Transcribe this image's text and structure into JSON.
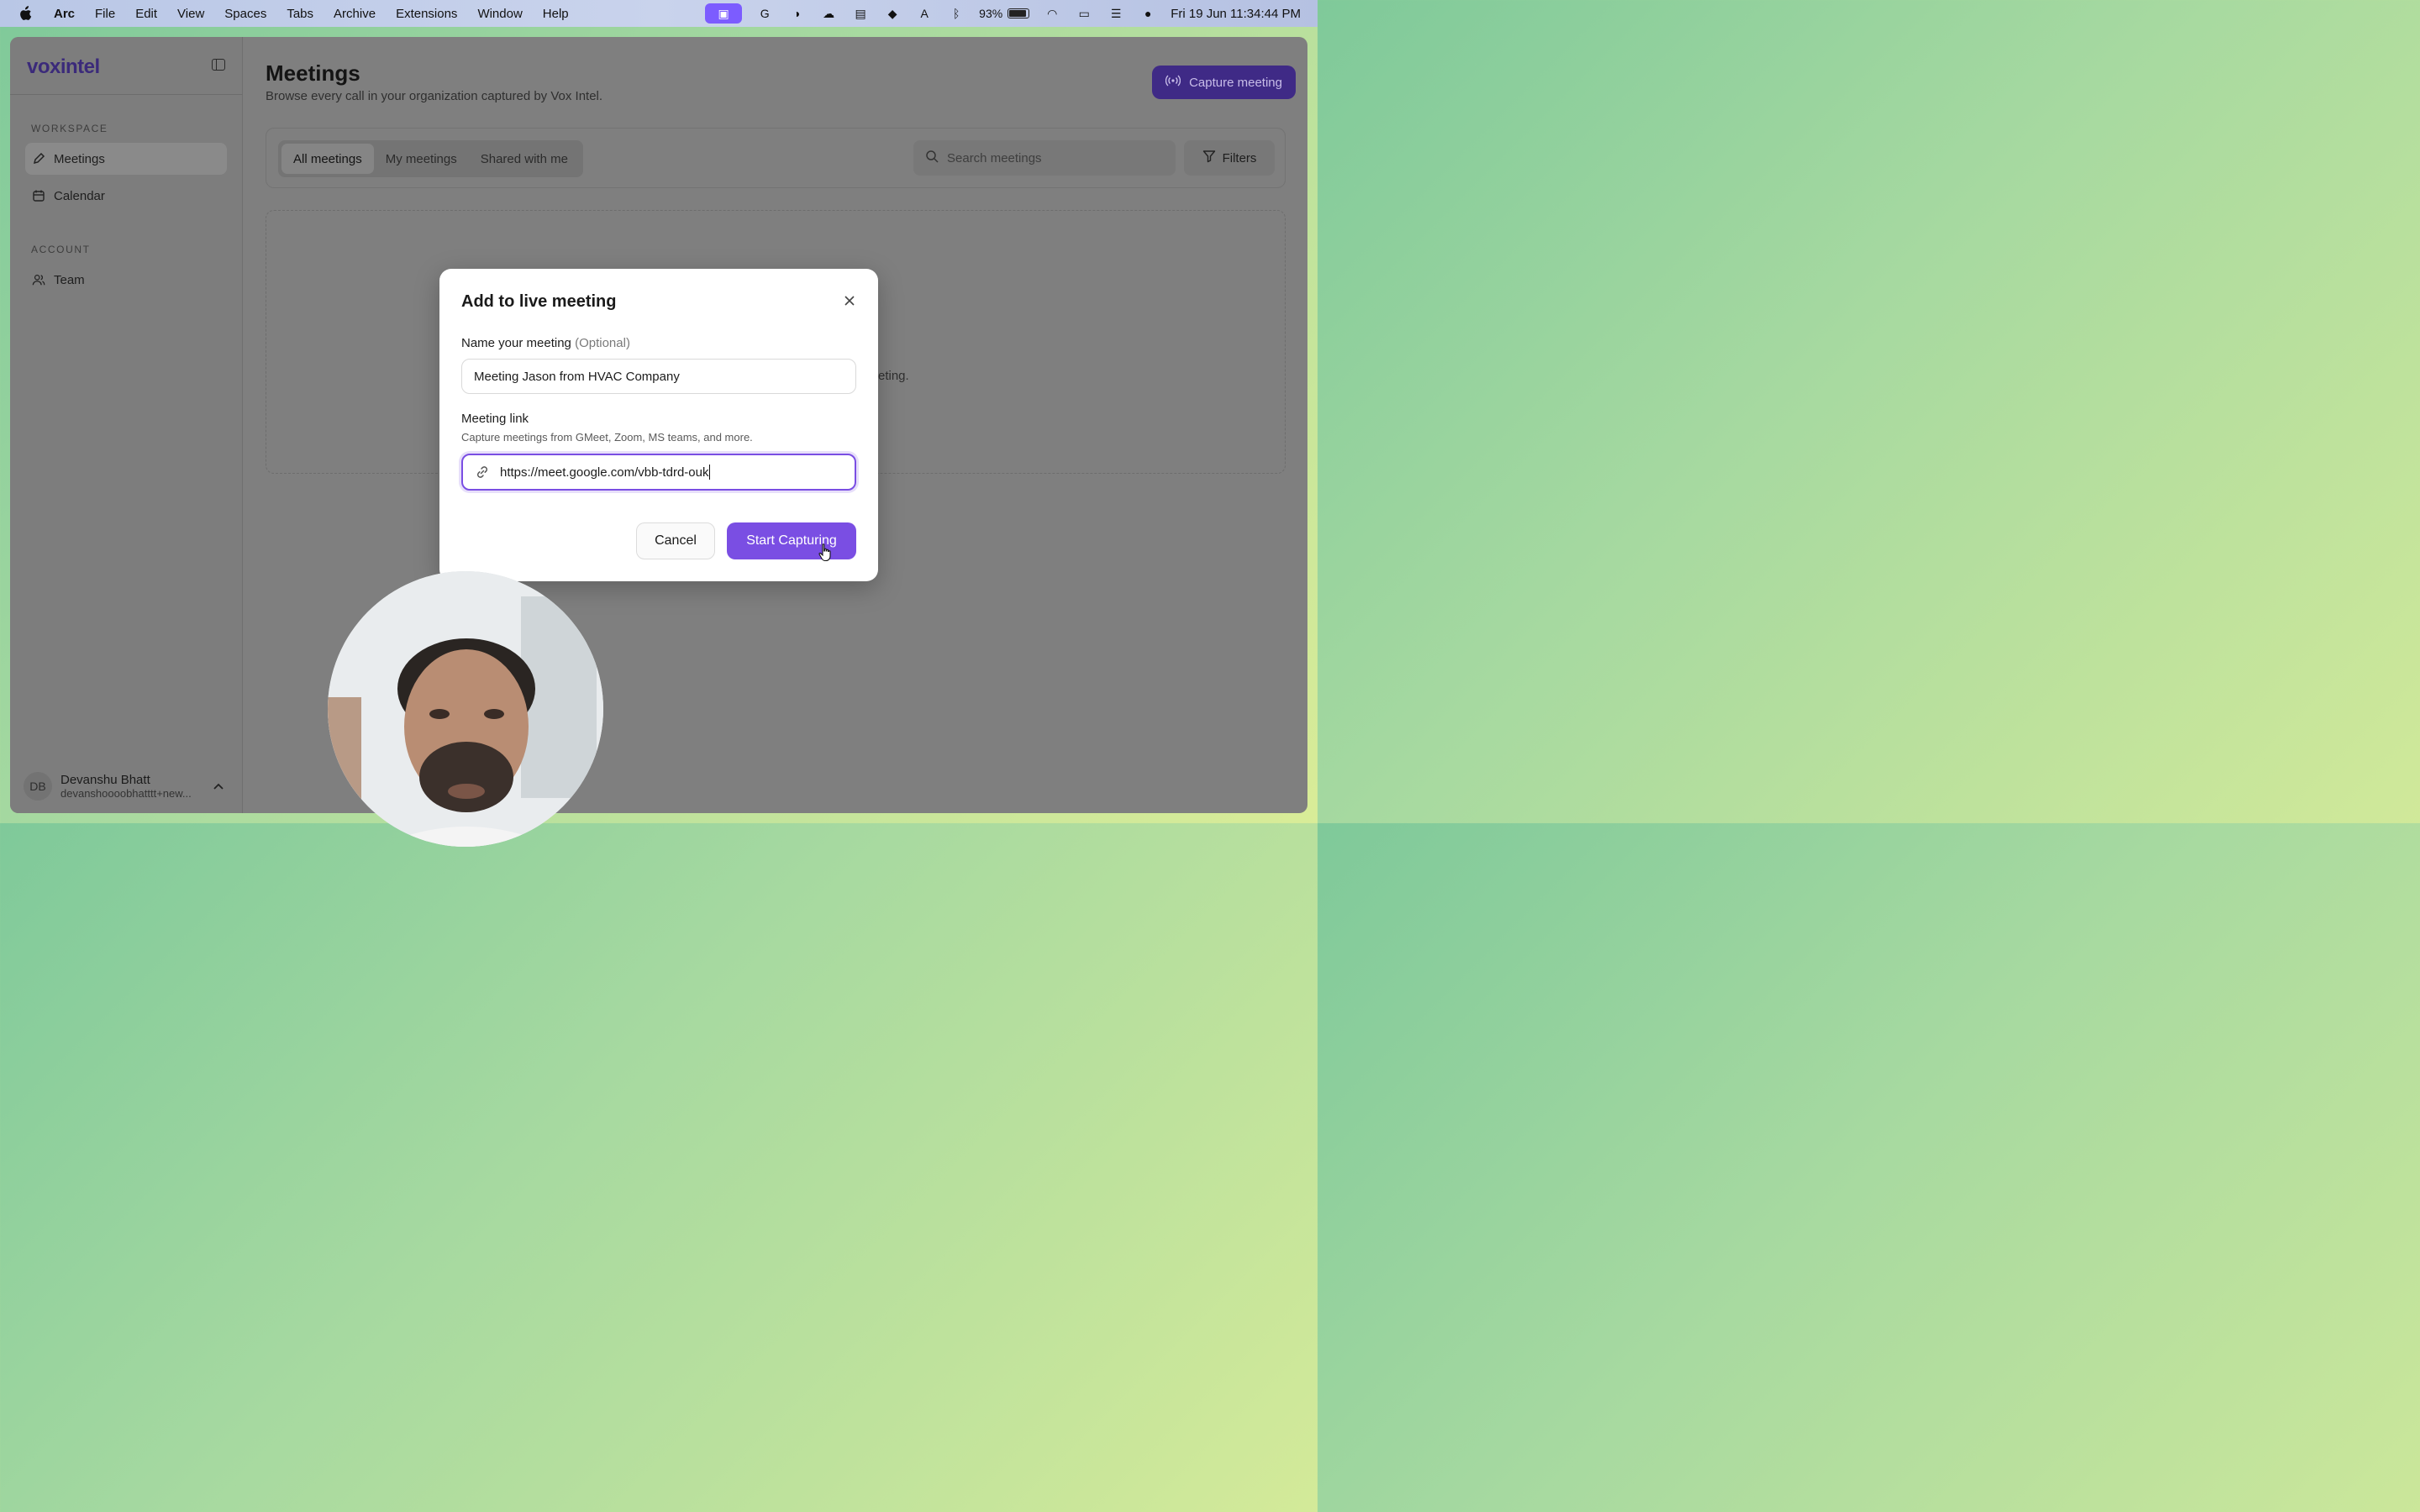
{
  "menubar": {
    "app_name": "Arc",
    "menus": [
      "File",
      "Edit",
      "View",
      "Spaces",
      "Tabs",
      "Archive",
      "Extensions",
      "Window",
      "Help"
    ],
    "battery": "93%",
    "clock": "Fri 19 Jun  11:34:44 PM"
  },
  "sidebar": {
    "logo": "voxintel",
    "workspace_label": "WORKSPACE",
    "account_label": "ACCOUNT",
    "items": [
      {
        "label": "Meetings",
        "icon": "pen-icon",
        "active": true
      },
      {
        "label": "Calendar",
        "icon": "calendar-icon",
        "active": false
      },
      {
        "label": "Team",
        "icon": "users-icon",
        "active": false
      }
    ],
    "user": {
      "initials": "DB",
      "name": "Devanshu Bhatt",
      "email": "devanshoooobhatttt+new..."
    }
  },
  "main": {
    "title": "Meetings",
    "subtitle": "Browse every call in your organization captured by Vox Intel.",
    "capture_button": "Capture meeting",
    "tabs": [
      "All meetings",
      "My meetings",
      "Shared with me"
    ],
    "search_placeholder": "Search meetings",
    "filters_label": "Filters",
    "empty_text_fragment": "eting."
  },
  "modal": {
    "title": "Add to live meeting",
    "name_label": "Name your meeting",
    "name_optional": "(Optional)",
    "name_value": "Meeting Jason from HVAC Company",
    "link_label": "Meeting link",
    "link_help": "Capture meetings from GMeet, Zoom, MS teams, and more.",
    "link_value": "https://meet.google.com/vbb-tdrd-ouk",
    "cancel_label": "Cancel",
    "start_label": "Start Capturing"
  },
  "colors": {
    "accent": "#7a4ee3",
    "overlay": "#7f7f7f"
  }
}
